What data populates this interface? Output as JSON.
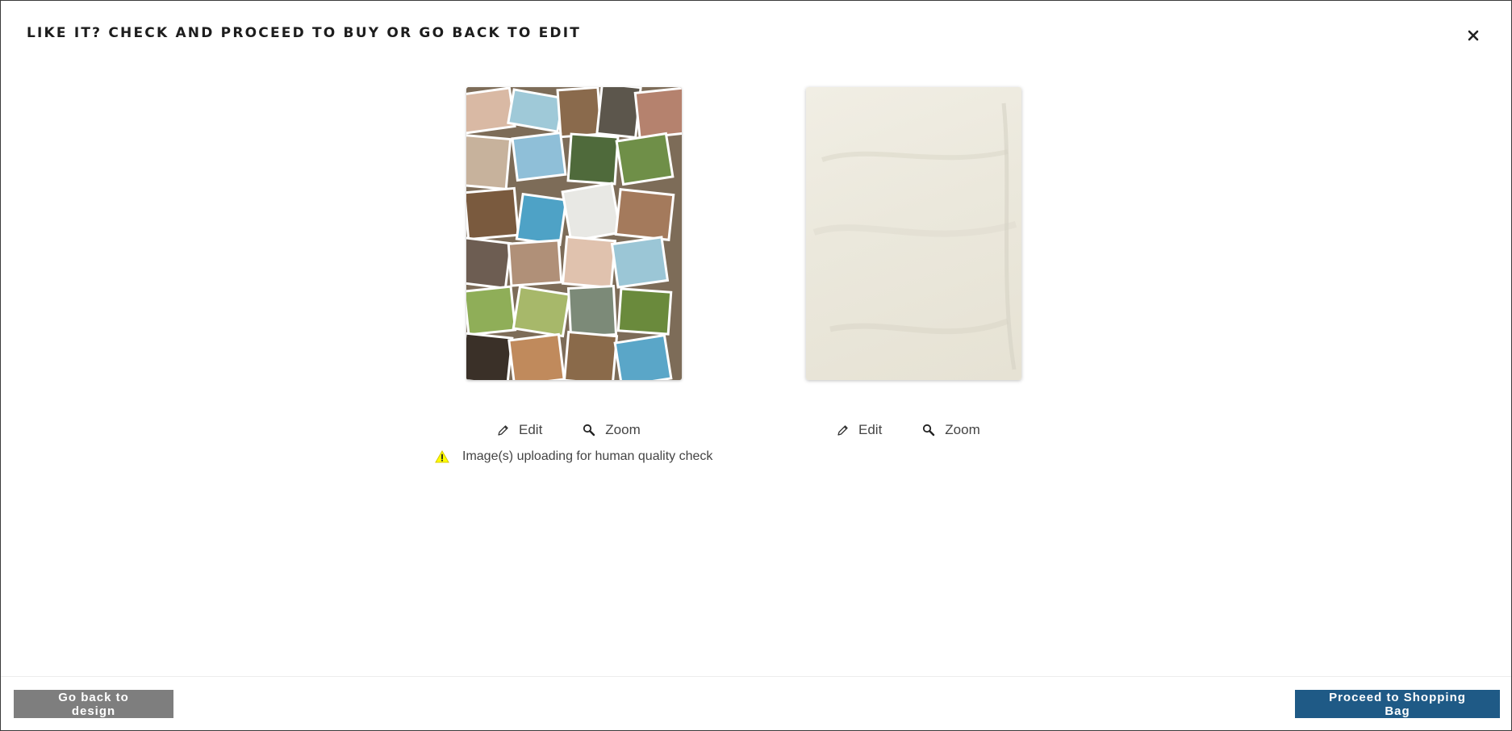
{
  "dialog": {
    "title": "LIKE IT? CHECK AND PROCEED TO BUY OR GO BACK TO EDIT",
    "close_icon": "close-icon"
  },
  "products": [
    {
      "preview": "photo-collage-blanket-preview",
      "actions": {
        "edit_label": "Edit",
        "zoom_label": "Zoom"
      },
      "warning": "Image(s) uploading for human quality check"
    },
    {
      "preview": "blank-blanket-preview",
      "actions": {
        "edit_label": "Edit",
        "zoom_label": "Zoom"
      }
    }
  ],
  "footer": {
    "back_label": "Go back to design",
    "proceed_label": "Proceed to Shopping Bag"
  },
  "colors": {
    "back_button": "#7e7e7e",
    "proceed_button": "#1f5a86",
    "warning_icon": "#ffff00"
  }
}
